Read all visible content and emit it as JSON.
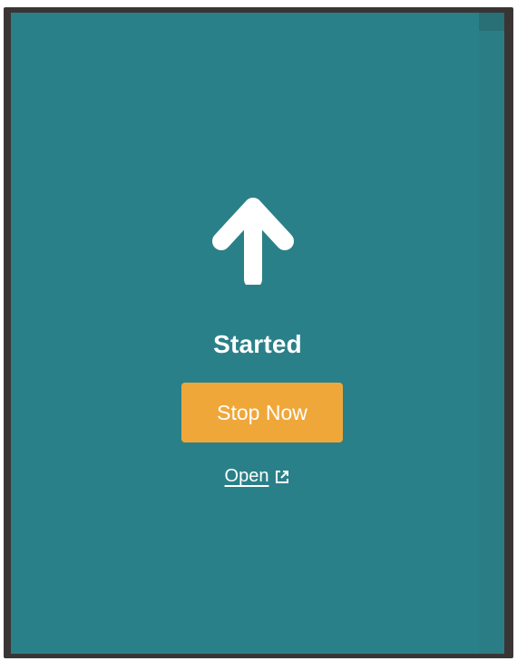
{
  "status": {
    "label": "Started",
    "icon": "arrow-up-icon"
  },
  "actions": {
    "stop_label": "Stop Now",
    "open_label": "Open",
    "open_icon": "external-link-icon"
  },
  "colors": {
    "panel_background": "#2a8088",
    "frame": "#3a3535",
    "stop_button": "#f0a73a",
    "text": "#ffffff"
  }
}
